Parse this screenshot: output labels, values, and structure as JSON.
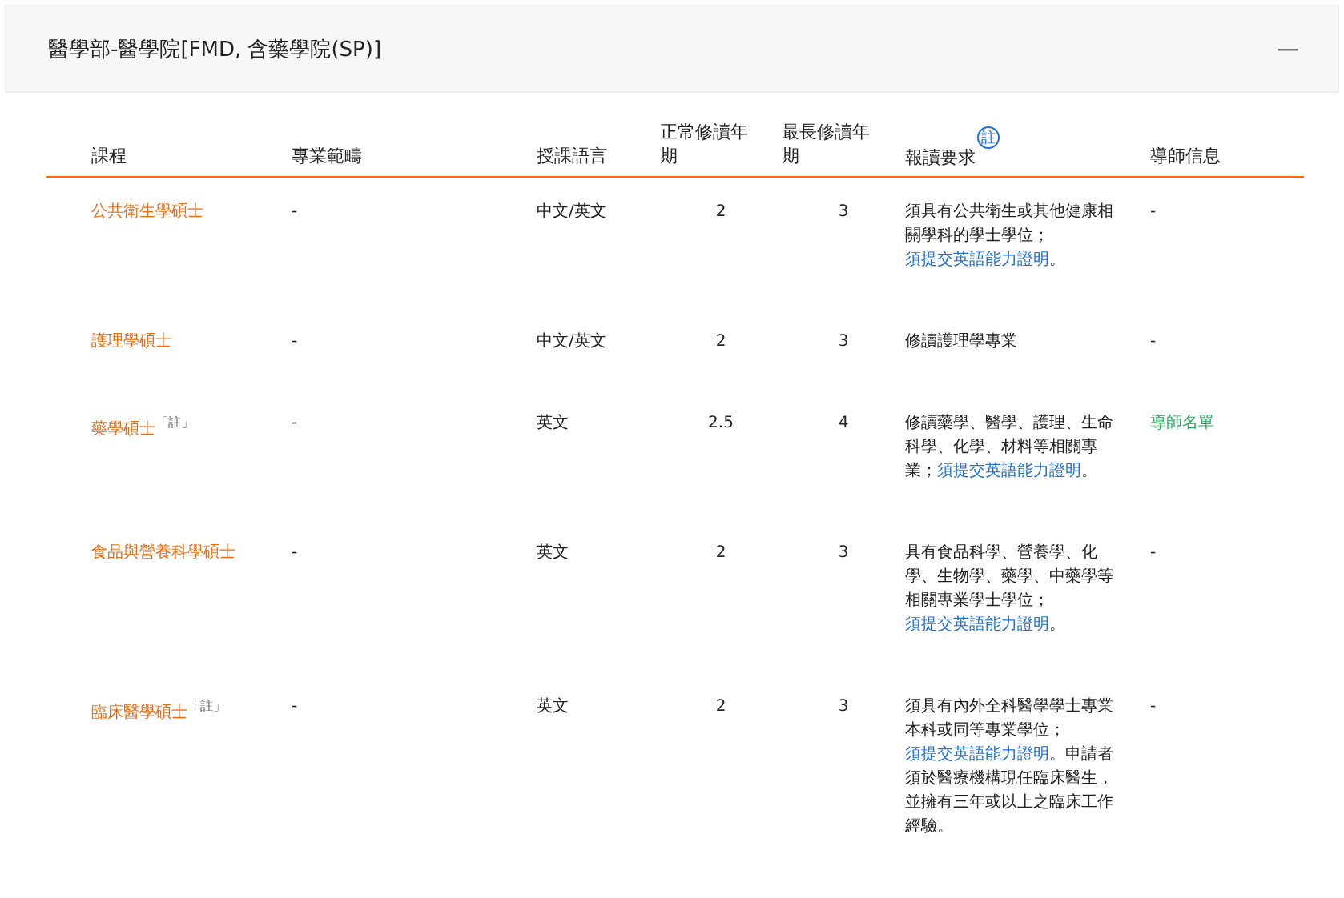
{
  "panel": {
    "title": "醫學部-醫學院[FMD, 含藥學院(SP)]",
    "collapse_icon": "—"
  },
  "table": {
    "columns": [
      {
        "label": "課程"
      },
      {
        "label": "專業範疇"
      },
      {
        "label": "授課語言"
      },
      {
        "label": "正常修讀年期"
      },
      {
        "label": "最長修讀年期"
      },
      {
        "label": "報讀要求",
        "note": "註"
      },
      {
        "label": "導師信息"
      }
    ],
    "rows": [
      {
        "course": "公共衛生學碩士",
        "scope": "-",
        "language": "中文/英文",
        "normal_years": "2",
        "max_years": "3",
        "requirement": {
          "before": "須具有公共衛生或其他健康相關學科的學士學位；",
          "link": "須提交英語能力證明",
          "after": "。"
        },
        "tutor": {
          "kind": "text",
          "text": "-"
        }
      },
      {
        "course": "護理學碩士",
        "scope": "-",
        "language": "中文/英文",
        "normal_years": "2",
        "max_years": "3",
        "requirement": {
          "before": "修讀護理學專業"
        },
        "tutor": {
          "kind": "text",
          "text": "-"
        }
      },
      {
        "course": "藥學碩士$^{「註」}$",
        "scope": "-",
        "language": "英文",
        "normal_years": "2.5",
        "max_years": "4",
        "requirement": {
          "before": "修讀藥學、醫學、護理、生命科學、化學、材料等相關專業；",
          "link": "須提交英語能力證明",
          "after": "。"
        },
        "tutor": {
          "kind": "link",
          "text": "導師名單"
        }
      },
      {
        "course": "食品與營養科學碩士",
        "scope": "-",
        "language": "英文",
        "normal_years": "2",
        "max_years": "3",
        "requirement": {
          "before": "具有食品科學、營養學、化學、生物學、藥學、中藥學等相關專業學士學位；",
          "link": "須提交英語能力證明",
          "after": "。"
        },
        "tutor": {
          "kind": "text",
          "text": "-"
        }
      },
      {
        "course": "臨床醫學碩士$^{「註」}$",
        "scope": "-",
        "language": "英文",
        "normal_years": "2",
        "max_years": "3",
        "requirement": {
          "before": "須具有內外全科醫學學士專業本科或同等專業學位；",
          "link": "須提交英語能力證明",
          "after": "。申請者須於醫療機構現任臨床醫生，並擁有三年或以上之臨床工作經驗。"
        },
        "tutor": {
          "kind": "text",
          "text": "-"
        }
      }
    ]
  }
}
